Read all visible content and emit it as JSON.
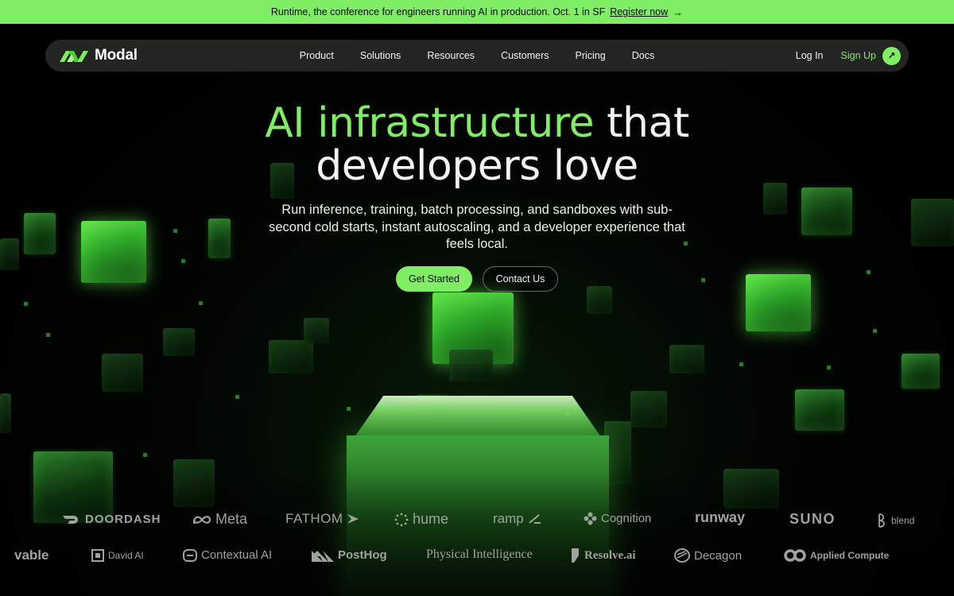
{
  "announcement": {
    "text": "Runtime, the conference for engineers running AI in production. Oct. 1 in SF",
    "link_label": "Register now"
  },
  "nav": {
    "brand": "Modal",
    "items": [
      {
        "label": "Product"
      },
      {
        "label": "Solutions"
      },
      {
        "label": "Resources"
      },
      {
        "label": "Customers"
      },
      {
        "label": "Pricing"
      },
      {
        "label": "Docs"
      }
    ],
    "login_label": "Log In",
    "signup_label": "Sign Up"
  },
  "hero": {
    "title_accent": "AI infrastructure",
    "title_rest_1": " that",
    "title_line_2": "developers love",
    "subtitle": "Run inference, training, batch processing, and sandboxes with sub-second cold starts, instant autoscaling, and a developer experience that feels local.",
    "primary_cta": "Get Started",
    "secondary_cta": "Contact Us"
  },
  "logos_row_1": [
    "DOORDASH",
    "Meta",
    "FATHOM",
    "hume",
    "ramp",
    "Cognition",
    "runway",
    "SUNO",
    "blend"
  ],
  "logos_row_2": [
    "vable",
    "David AI",
    "Contextual AI",
    "PostHog",
    "Physical Intelligence",
    "Resolve.ai",
    "Decagon",
    "Applied Compute"
  ],
  "colors": {
    "accent": "#7fee64",
    "background": "#000000",
    "nav_bg": "#262826",
    "logo_gray": "#9ea39e"
  }
}
